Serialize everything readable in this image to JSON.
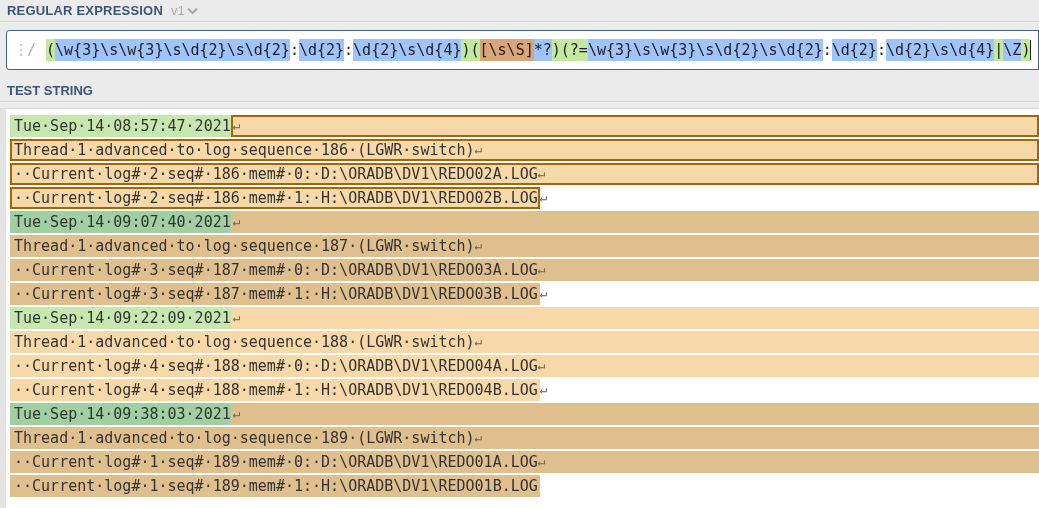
{
  "regex_section": {
    "title": "REGULAR EXPRESSION",
    "version": "v1",
    "delimiter": "/",
    "tokens": [
      {
        "text": "(",
        "kind": "group"
      },
      {
        "text": "\\w{3}\\s\\w{3}\\s\\d{2}\\s\\d{2}",
        "kind": "escape"
      },
      {
        "text": ":",
        "kind": "plain"
      },
      {
        "text": "\\d{2}",
        "kind": "escape"
      },
      {
        "text": ":",
        "kind": "plain"
      },
      {
        "text": "\\d{2}\\s\\d{4}",
        "kind": "escape"
      },
      {
        "text": ")(",
        "kind": "group"
      },
      {
        "text": "[\\s\\S]",
        "kind": "class"
      },
      {
        "text": "*?",
        "kind": "escape"
      },
      {
        "text": ")(?=",
        "kind": "group"
      },
      {
        "text": "\\w{3}\\s\\w{3}\\s\\d{2}\\s\\d{2}",
        "kind": "escape"
      },
      {
        "text": ":",
        "kind": "plain"
      },
      {
        "text": "\\d{2}",
        "kind": "escape"
      },
      {
        "text": ":",
        "kind": "plain"
      },
      {
        "text": "\\d{2}\\s\\d{4}",
        "kind": "escape"
      },
      {
        "text": "|",
        "kind": "group"
      },
      {
        "text": "\\Z",
        "kind": "escape"
      },
      {
        "text": ")",
        "kind": "group"
      }
    ]
  },
  "test_section": {
    "title": "TEST STRING",
    "matches": [
      {
        "selected": true,
        "kind": "light",
        "date": "Tue·Sep·14·08:57:47·2021",
        "date_eol": "↵",
        "lines": [
          {
            "text": "Thread·1·advanced·to·log·sequence·186·(LGWR·switch)",
            "eol": "↵",
            "kind": "full"
          },
          {
            "text": "··Current·log#·2·seq#·186·mem#·0:·D:\\ORADB\\DV1\\REDO02A.LOG",
            "eol": "↵",
            "kind": "full"
          },
          {
            "text": "··Current·log#·2·seq#·186·mem#·1:·H:\\ORADB\\DV1\\REDO02B.LOG",
            "eol": "↵",
            "kind": "trim"
          }
        ]
      },
      {
        "selected": false,
        "kind": "dark",
        "date": "Tue·Sep·14·09:07:40·2021",
        "date_eol": "↵",
        "lines": [
          {
            "text": "Thread·1·advanced·to·log·sequence·187·(LGWR·switch)",
            "eol": "↵",
            "kind": "full"
          },
          {
            "text": "··Current·log#·3·seq#·187·mem#·0:·D:\\ORADB\\DV1\\REDO03A.LOG",
            "eol": "↵",
            "kind": "full"
          },
          {
            "text": "··Current·log#·3·seq#·187·mem#·1:·H:\\ORADB\\DV1\\REDO03B.LOG",
            "eol": "↵",
            "kind": "trim"
          }
        ]
      },
      {
        "selected": false,
        "kind": "light",
        "date": "Tue·Sep·14·09:22:09·2021",
        "date_eol": "↵",
        "lines": [
          {
            "text": "Thread·1·advanced·to·log·sequence·188·(LGWR·switch)",
            "eol": "↵",
            "kind": "full"
          },
          {
            "text": "··Current·log#·4·seq#·188·mem#·0:·D:\\ORADB\\DV1\\REDO04A.LOG",
            "eol": "↵",
            "kind": "full"
          },
          {
            "text": "··Current·log#·4·seq#·188·mem#·1:·H:\\ORADB\\DV1\\REDO04B.LOG",
            "eol": "↵",
            "kind": "trim"
          }
        ]
      },
      {
        "selected": false,
        "kind": "dark",
        "date": "Tue·Sep·14·09:38:03·2021",
        "date_eol": "↵",
        "lines": [
          {
            "text": "Thread·1·advanced·to·log·sequence·189·(LGWR·switch)",
            "eol": "↵",
            "kind": "full"
          },
          {
            "text": "··Current·log#·1·seq#·189·mem#·0:·D:\\ORADB\\DV1\\REDO01A.LOG",
            "eol": "↵",
            "kind": "full"
          },
          {
            "text": "··Current·log#·1·seq#·189·mem#·1:·H:\\ORADB\\DV1\\REDO01B.LOG",
            "kind": "trim"
          }
        ]
      }
    ]
  }
}
